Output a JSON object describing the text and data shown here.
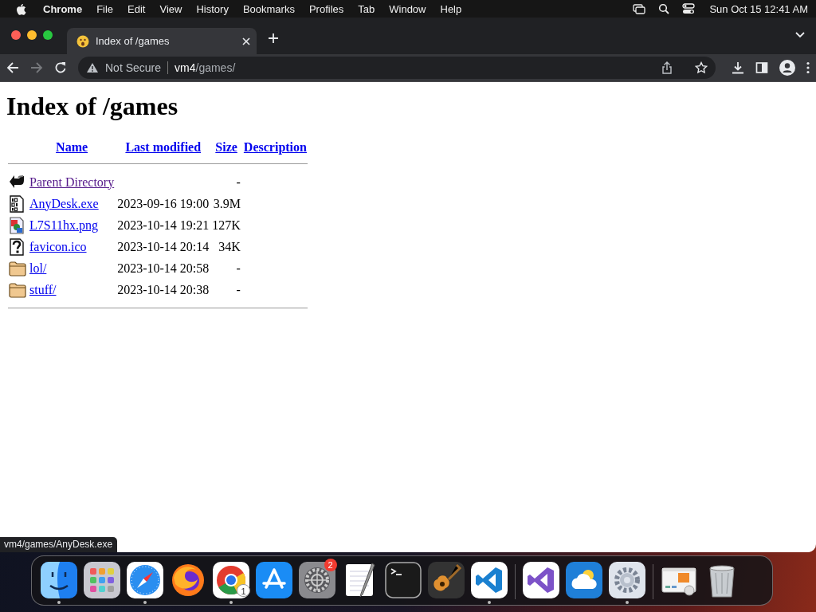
{
  "menubar": {
    "app": "Chrome",
    "menus": [
      "File",
      "Edit",
      "View",
      "History",
      "Bookmarks",
      "Profiles",
      "Tab",
      "Window",
      "Help"
    ],
    "clock": "Sun Oct 15  12:41 AM"
  },
  "tabs": [
    {
      "title": "Index of /games",
      "selected": true
    }
  ],
  "toolbar": {
    "forward_disabled": true,
    "security": "Not Secure",
    "url": {
      "host": "vm4",
      "path": "/games/"
    }
  },
  "page": {
    "heading": "Index of /games",
    "columns": [
      "Name",
      "Last modified",
      "Size",
      "Description"
    ],
    "rows": [
      {
        "kind": "back",
        "name": "Parent Directory",
        "visited": true,
        "size": "-"
      },
      {
        "kind": "binary",
        "name": "AnyDesk.exe",
        "visited": false,
        "modified": "2023-09-16 19:00",
        "size": "3.9M"
      },
      {
        "kind": "image",
        "name": "L7S11hx.png",
        "visited": false,
        "modified": "2023-10-14 19:21",
        "size": "127K"
      },
      {
        "kind": "unknown",
        "name": "favicon.ico",
        "visited": false,
        "modified": "2023-10-14 20:14",
        "size": "34K"
      },
      {
        "kind": "folder",
        "name": "lol/",
        "visited": false,
        "modified": "2023-10-14 20:58",
        "size": "-"
      },
      {
        "kind": "folder",
        "name": "stuff/",
        "visited": false,
        "modified": "2023-10-14 20:38",
        "size": "-"
      }
    ]
  },
  "status_url": "vm4/games/AnyDesk.exe",
  "dock": [
    {
      "kind": "finder",
      "running": true
    },
    {
      "kind": "launchpad",
      "running": false
    },
    {
      "kind": "safari",
      "running": true
    },
    {
      "kind": "firefox",
      "running": false
    },
    {
      "kind": "chrome",
      "running": true,
      "badge": "1"
    },
    {
      "kind": "appstore",
      "running": false
    },
    {
      "kind": "settings",
      "running": false,
      "badge": "2"
    },
    {
      "kind": "textedit",
      "running": false
    },
    {
      "kind": "terminal",
      "running": false
    },
    {
      "kind": "guitar",
      "running": false
    },
    {
      "kind": "vscode",
      "running": true
    },
    {
      "kind": "separator"
    },
    {
      "kind": "vs",
      "running": false
    },
    {
      "kind": "weather",
      "running": false
    },
    {
      "kind": "gearapp",
      "running": true
    },
    {
      "kind": "separator"
    },
    {
      "kind": "preview",
      "running": false
    },
    {
      "kind": "trash",
      "running": false
    }
  ]
}
